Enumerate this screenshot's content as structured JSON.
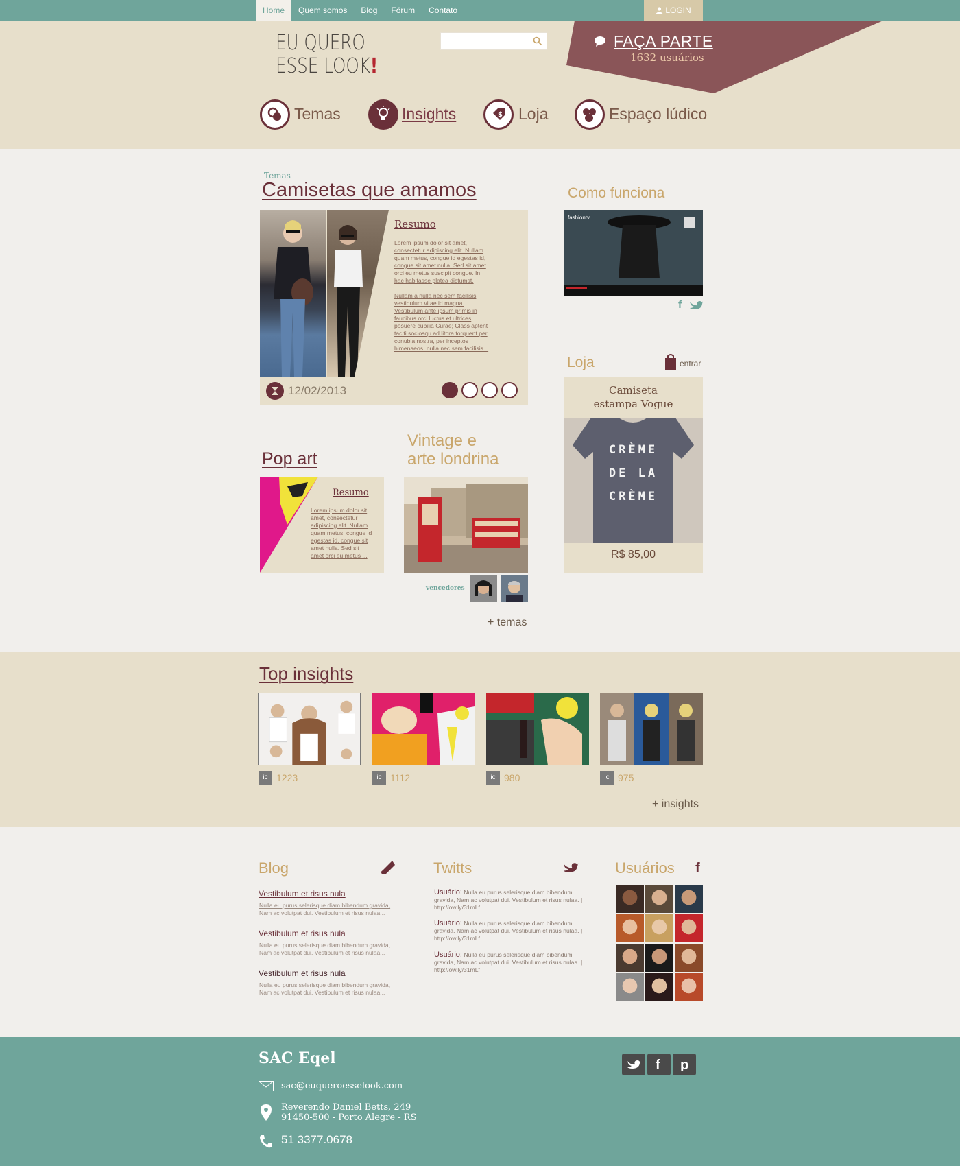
{
  "topnav": {
    "items": [
      "Home",
      "Quem somos",
      "Blog",
      "Fórum",
      "Contato"
    ],
    "login": "LOGIN"
  },
  "header": {
    "logo_line1": "EU QUERO",
    "logo_line2": "ESSE LOOK",
    "logo_bang": "!",
    "search_placeholder": "",
    "cta": "FAÇA PARTE",
    "user_count": "1632 usuários"
  },
  "mainnav": {
    "items": [
      "Temas",
      "Insights",
      "Loja",
      "Espaço lúdico"
    ],
    "active": "Insights"
  },
  "featured": {
    "crumb": "Temas",
    "title": "Camisetas que amamos",
    "resumo_title": "Resumo",
    "resumo_p1": "Lorem ipsum dolor sit amet, consectetur adipiscing elit. Nullam quam metus, congue id egestas id, congue sit amet nulla. Sed sit amet orci eu metus suscipit congue. In hac habitasse platea dictumst.",
    "resumo_p2": "Nullam a nulla nec sem facilisis vestibulum vitae id magna. Vestibulum ante ipsum primis in faucibus orci luctus et ultrices posuere cubilia Curae; Class aptent taciti sociosqu ad litora torquent per conubia nostra, per inceptos himenaeos. nulla nec sem facilisis...",
    "date": "12/02/2013"
  },
  "popart": {
    "title": "Pop art",
    "resumo_title": "Resumo",
    "resumo_text": "Lorem ipsum dolor sit amet, consectetur adipiscing elit. Nullam quam metus, congue id egestas id, congue sit amet nulla. Sed sit amet orci eu metus ..."
  },
  "vintage": {
    "title_line1": "Vintage e",
    "title_line2": "arte londrina",
    "winners_label": "vencedores"
  },
  "more_temas": "+ temas",
  "sidebar": {
    "como_funciona": "Como funciona",
    "video_brand": "fashiontv",
    "loja_title": "Loja",
    "loja_enter": "entrar",
    "product_line1": "Camiseta",
    "product_line2": "estampa Vogue",
    "shirt_line1": "CRÈME",
    "shirt_line2": "DE LA",
    "shirt_line3": "CRÈME",
    "price": "R$ 85,00"
  },
  "top_insights": {
    "title": "Top insights",
    "items": [
      {
        "badge": "ic",
        "count": "1223"
      },
      {
        "badge": "ic",
        "count": "1112"
      },
      {
        "badge": "ic",
        "count": "980"
      },
      {
        "badge": "ic",
        "count": "975"
      }
    ],
    "more": "+ insights"
  },
  "blog": {
    "title": "Blog",
    "posts": [
      {
        "title": "Vestibulum et risus nula",
        "body": "Nulla eu purus selerisque diam bibendum gravida, Nam ac volutpat dui. Vestibulum et risus nulaa..."
      },
      {
        "title": "Vestibulum et risus nula",
        "body": "Nulla eu purus selerisque diam bibendum gravida, Nam ac volutpat dui. Vestibulum et risus nulaa..."
      },
      {
        "title": "Vestibulum et risus nula",
        "body": "Nulla eu purus selerisque diam bibendum gravida, Nam ac volutpat dui. Vestibulum et risus nulaa..."
      }
    ]
  },
  "twitts": {
    "title": "Twitts",
    "items": [
      {
        "user": "Usuário:",
        "text": "Nulla eu purus selerisque diam bibendum gravida, Nam ac volutpat dui. Vestibulum et risus nulaa. | http://ow.ly/31mLf"
      },
      {
        "user": "Usuário:",
        "text": "Nulla eu purus selerisque diam bibendum gravida, Nam ac volutpat dui. Vestibulum et risus nulaa. | http://ow.ly/31mLf"
      },
      {
        "user": "Usuário:",
        "text": "Nulla eu purus selerisque diam bibendum gravida, Nam ac volutpat dui. Vestibulum et risus nulaa. | http://ow.ly/31mLf"
      }
    ]
  },
  "usuarios": {
    "title": "Usuários"
  },
  "footer": {
    "title": "SAC Eqel",
    "email": "sac@euqueroesselook.com",
    "address1": "Reverendo Daniel Betts, 249",
    "address2": "91450-500 - Porto Alegre - RS",
    "phone": "51 3377.0678",
    "social": [
      "twitter-icon",
      "facebook-icon",
      "pinterest-icon"
    ]
  },
  "colors": {
    "teal": "#6fa59b",
    "beige": "#e7dfcb",
    "burgundy": "#6a3039",
    "gold": "#c9a66b",
    "ribbon": "#8a5558"
  }
}
